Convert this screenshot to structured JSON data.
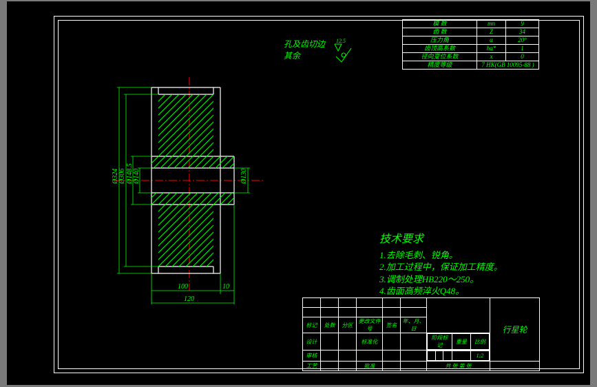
{
  "surface_note": {
    "line1": "孔及齿切边",
    "line2": "其余",
    "triangle_value": "12.5"
  },
  "params": {
    "rows": [
      {
        "label": "模 数",
        "sym": "mn",
        "val": "9"
      },
      {
        "label": "齿 数",
        "sym": "Z",
        "val": "34"
      },
      {
        "label": "压力角",
        "sym": "α",
        "val": "20°"
      },
      {
        "label": "齿顶高系数",
        "sym": "ha*",
        "val": "1"
      },
      {
        "label": "径向变位系数",
        "sym": "x",
        "val": "0"
      }
    ],
    "precision_label": "精度等级",
    "precision_value": "7 HK(GB 10095-88   )"
  },
  "tech_req": {
    "title": "技术要求",
    "items": [
      "1.去除毛刺、锐角。",
      "2.加工过程中，保证加工精度。",
      "3.调制处理HB220～250。",
      "4.齿面高频淬火Q48。"
    ]
  },
  "dimensions": {
    "outer_dia": "Ø324",
    "mid_dia_1": "Ø306",
    "mid_dia_2": "Ø148.5",
    "inner_dia": "Ø140",
    "hub_dia": "Ø130",
    "width_main": "100",
    "width_step": "10",
    "width_total": "120"
  },
  "title_block": {
    "headers": {
      "mark": "标记",
      "zone": "处数",
      "div": "分区",
      "change": "更改文件号",
      "sign": "签名",
      "date": "年、月、日"
    },
    "rows": {
      "design": "设计",
      "standard": "标准化",
      "stage_mark": "阶段标记",
      "weight": "重量",
      "scale": "比例",
      "check": "审核",
      "process": "工艺",
      "approve": "批准",
      "sheets": "共   张   第   张"
    },
    "part_name": "行星轮",
    "scale_value": "1:2"
  }
}
